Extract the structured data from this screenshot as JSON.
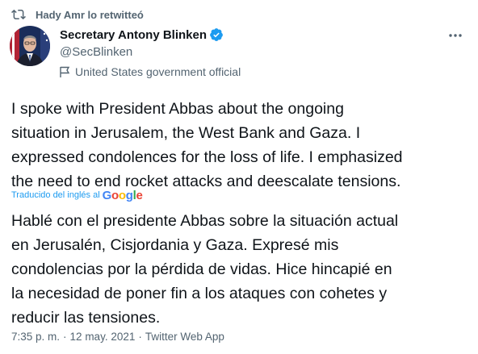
{
  "retweet": {
    "label": "Hady Amr lo retwitteó",
    "icon": "retweet-icon"
  },
  "author": {
    "display_name": "Secretary Antony Blinken",
    "handle": "@SecBlinken",
    "account_label": "United States government official",
    "verified_icon": "verified-badge-icon",
    "avatar": "avatar"
  },
  "more_icon": "more-options-icon",
  "tweet": {
    "text_lines": [
      "I spoke with President Abbas about the ongoing",
      "situation in Jerusalem, the West Bank and Gaza. I",
      "expressed condolences for the loss of life. I emphasized",
      "the need to end rocket attacks and deescalate tensions."
    ],
    "translation_label": "Traducido del inglés al",
    "translation_provider": "Google",
    "translated_lines": [
      "Hablé con el presidente Abbas sobre la situación actual",
      "en Jerusalén, Cisjordania y Gaza. Expresé mis",
      "condolencias por la pérdida de vidas. Hice hincapié en",
      "la necesidad de poner fin a los ataques con cohetes y",
      "reducir las tensiones."
    ]
  },
  "meta": {
    "time": "7:35 p. m.",
    "date": "12 may. 2021",
    "source": "Twitter Web App",
    "separator": "·"
  },
  "colors": {
    "accent": "#1d9bf0",
    "secondary_text": "#536471",
    "primary_text": "#0f1419"
  }
}
